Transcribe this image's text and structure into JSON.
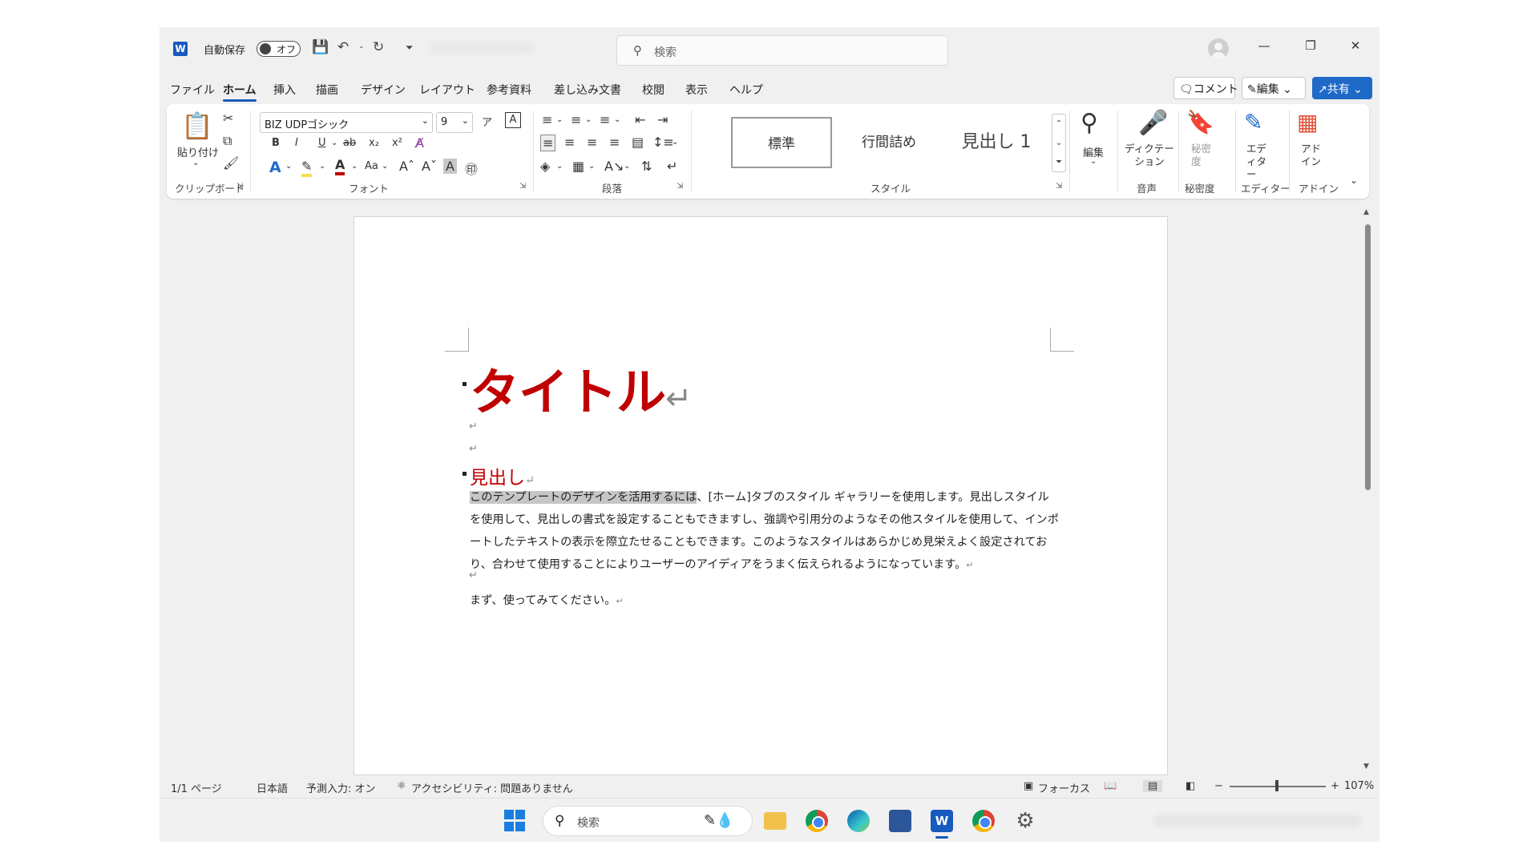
{
  "titlebar": {
    "app_icon": "W",
    "autosave_label": "自動保存",
    "autosave_state": "オフ",
    "search_placeholder": "検索"
  },
  "tabs": [
    "ファイル",
    "ホーム",
    "挿入",
    "描画",
    "デザイン",
    "レイアウト",
    "参考資料",
    "差し込み文書",
    "校閲",
    "表示",
    "ヘルプ"
  ],
  "active_tab": "ホーム",
  "header_buttons": {
    "comment": "コメント",
    "edit": "編集",
    "share": "共有"
  },
  "ribbon": {
    "clipboard": {
      "paste": "貼り付け",
      "group": "クリップボード"
    },
    "font": {
      "font_name": "BIZ UDPゴシック",
      "font_size": "9",
      "group": "フォント",
      "bold": "B",
      "italic": "I",
      "underline": "U",
      "strike": "ab",
      "subscript": "x₂",
      "superscript": "x²",
      "change_case": "Aa"
    },
    "paragraph": {
      "group": "段落"
    },
    "styles": {
      "items": [
        "標準",
        "行間詰め",
        "見出し 1"
      ],
      "group": "スタイル"
    },
    "editing": {
      "label": "編集"
    },
    "dictation": {
      "label": "ディクテーション",
      "group": "音声"
    },
    "sensitivity": {
      "label": "秘密度",
      "group": "秘密度"
    },
    "editor": {
      "label": "エディター",
      "group": "エディター"
    },
    "addins": {
      "label": "アドイン",
      "group": "アドイン"
    }
  },
  "document": {
    "title": "タイトル",
    "heading": "見出し",
    "body_highlighted": "このテンプレートのデザインを活用するには",
    "body_rest": "、[ホーム]タブのスタイル ギャラリーを使用します。見出しスタイルを使用して、見出しの書式を設定することもできますし、強調や引用分のようなその他スタイルを使用して、インポートしたテキストの表示を際立たせることもできます。このようなスタイルはあらかじめ見栄えよく設定されており、合わせて使用することによりユーザーのアイディアをうまく伝えられるようになっています。",
    "closing": "まず、使ってみてください。",
    "para_mark": "↵"
  },
  "statusbar": {
    "page": "1/1 ページ",
    "language": "日本語",
    "predictive": "予測入力: オン",
    "accessibility": "アクセシビリティ: 問題ありません",
    "focus": "フォーカス",
    "zoom": "107%",
    "zoom_minus": "−",
    "zoom_plus": "+"
  },
  "taskbar": {
    "search_placeholder": "検索"
  }
}
